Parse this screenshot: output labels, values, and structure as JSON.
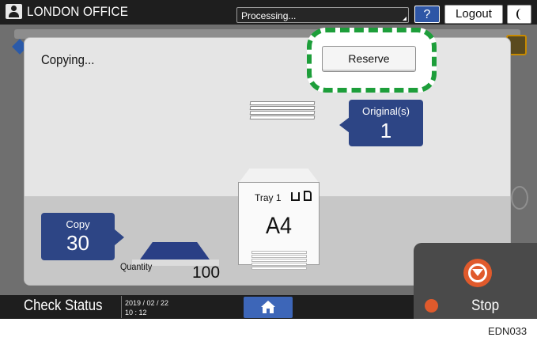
{
  "header": {
    "office_name": "LONDON OFFICE",
    "status_text": "Processing...",
    "help_label": "?",
    "logout_label": "Logout"
  },
  "dialog": {
    "title": "Copying...",
    "reserve_label": "Reserve",
    "originals": {
      "label": "Original(s)",
      "count": "1"
    },
    "tray": {
      "label": "Tray 1",
      "paper_size": "A4"
    },
    "copy": {
      "label": "Copy",
      "count": "30"
    },
    "quantity": {
      "label": "Quantity",
      "value": "100"
    }
  },
  "footer": {
    "check_status_label": "Check Status",
    "date": "2019 / 02 / 22",
    "time": "10 : 12",
    "stop_label": "Stop"
  },
  "figure_code": "EDN033",
  "colors": {
    "badge_blue": "#2d4585",
    "highlight_green": "#1d9e3a",
    "stop_orange": "#e05a2c",
    "home_blue": "#3d66b8"
  },
  "icons": [
    "user-icon",
    "moon-icon",
    "home-icon",
    "stop-icon",
    "tray-icon"
  ]
}
